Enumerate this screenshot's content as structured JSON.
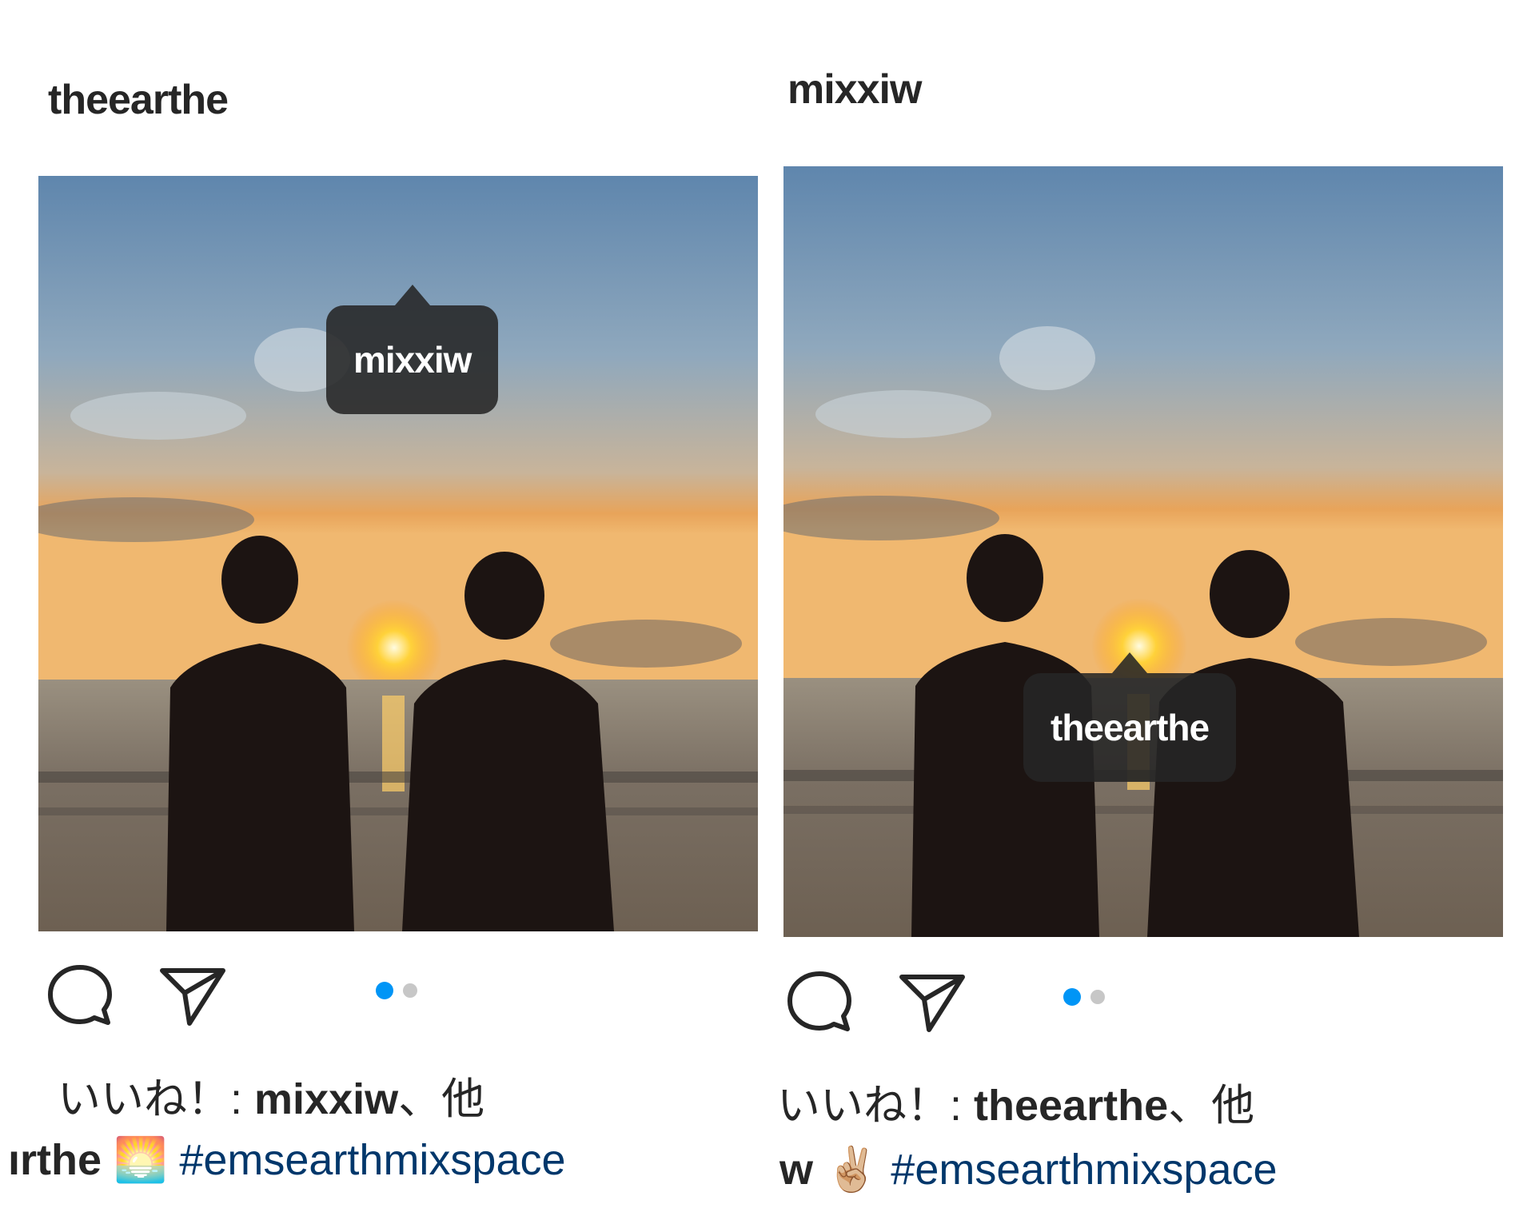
{
  "theme": {
    "hashtag_color": "#00376b",
    "active_dot_color": "#0095f6",
    "inactive_dot_color": "#c7c7c7"
  },
  "posts": [
    {
      "username": "theearthe",
      "photo_icon": "sunset-beach-photo",
      "tag_label": "mixxiw",
      "carousel": {
        "current": 1,
        "total": 2
      },
      "likes": {
        "prefix": "いいね！: ",
        "user": "mixxiw",
        "suffix": "、他"
      },
      "caption": {
        "author": "ırthe",
        "emoji": "🌅",
        "hashtag": "#emsearthmixspace"
      }
    },
    {
      "username": "mixxiw",
      "photo_icon": "sunset-beach-photo",
      "tag_label": "theearthe",
      "carousel": {
        "current": 1,
        "total": 2
      },
      "likes": {
        "prefix": "いいね！: ",
        "user": "theearthe",
        "suffix": "、他"
      },
      "caption": {
        "author": "w",
        "emoji": "✌🏼",
        "hashtag": "#emsearthmixspace"
      }
    }
  ]
}
